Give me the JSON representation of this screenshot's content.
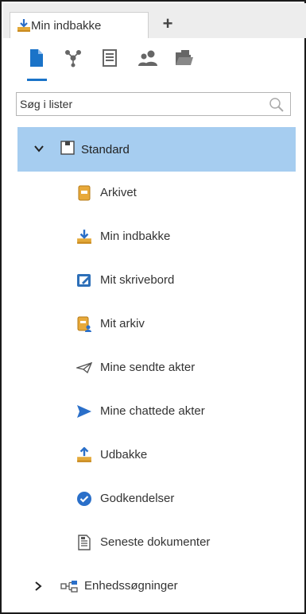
{
  "tabs": [
    {
      "label": "Min indbakke",
      "icon": "inbox-download-icon"
    }
  ],
  "add_tab_label": "+",
  "toolbar": {
    "items": [
      {
        "name": "document-icon",
        "active": true
      },
      {
        "name": "network-icon"
      },
      {
        "name": "list-icon"
      },
      {
        "name": "users-icon"
      },
      {
        "name": "folder-icon"
      }
    ]
  },
  "search": {
    "placeholder": "Søg i lister",
    "value": ""
  },
  "tree": {
    "standard": {
      "label": "Standard",
      "expanded": true,
      "children": [
        {
          "label": "Arkivet",
          "icon": "archive-icon"
        },
        {
          "label": "Min indbakke",
          "icon": "inbox-download-icon"
        },
        {
          "label": "Mit skrivebord",
          "icon": "desktop-edit-icon"
        },
        {
          "label": "Mit arkiv",
          "icon": "personal-archive-icon"
        },
        {
          "label": "Mine sendte akter",
          "icon": "paper-plane-outline-icon"
        },
        {
          "label": "Mine chattede akter",
          "icon": "send-arrow-icon"
        },
        {
          "label": "Udbakke",
          "icon": "outbox-upload-icon"
        },
        {
          "label": "Godkendelser",
          "icon": "check-circle-icon"
        },
        {
          "label": "Seneste dokumenter",
          "icon": "recent-document-icon"
        }
      ]
    },
    "entity_searches": {
      "label": "Enhedssøgninger",
      "expanded": false,
      "icon": "hierarchy-icon"
    }
  },
  "colors": {
    "selection": "#a6cdf0",
    "accent": "#1a73c8",
    "tab_strip": "#ededed"
  }
}
